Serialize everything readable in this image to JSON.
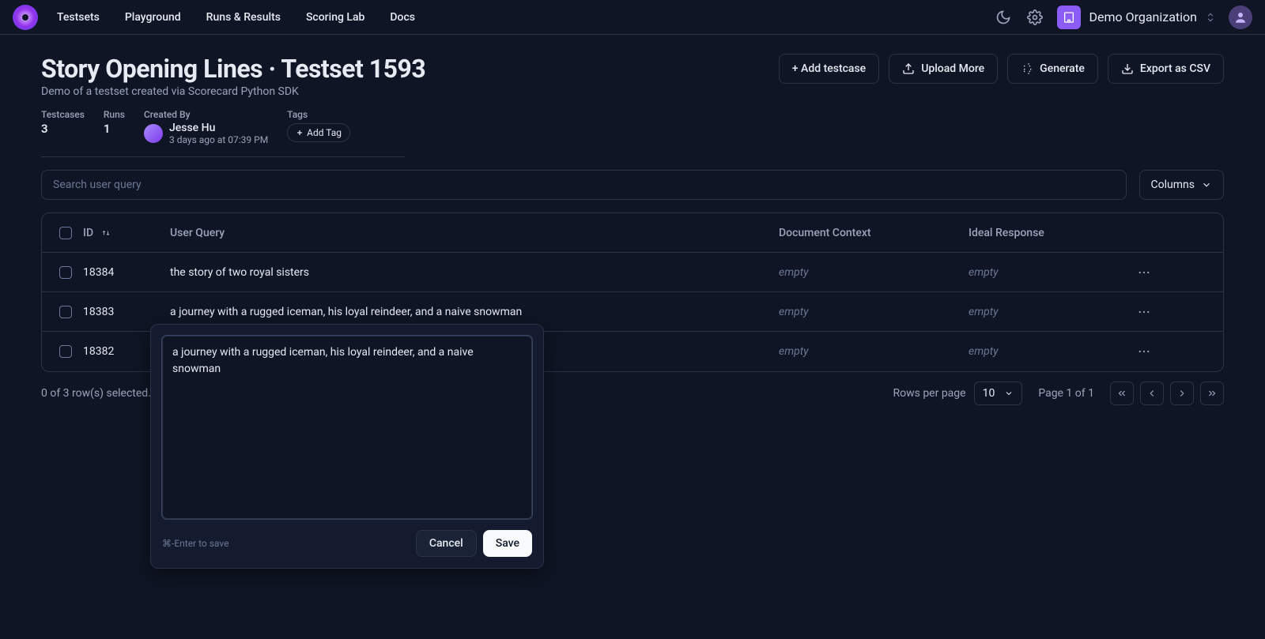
{
  "nav": {
    "items": [
      "Testsets",
      "Playground",
      "Runs & Results",
      "Scoring Lab",
      "Docs"
    ]
  },
  "org": {
    "name": "Demo Organization"
  },
  "page": {
    "title": "Story Opening Lines · Testset 1593",
    "subtitle": "Demo of a testset created via Scorecard Python SDK"
  },
  "meta": {
    "testcases_label": "Testcases",
    "testcases_value": "3",
    "runs_label": "Runs",
    "runs_value": "1",
    "created_by_label": "Created By",
    "creator_name": "Jesse Hu",
    "creator_time": "3 days ago at 07:39 PM",
    "tags_label": "Tags",
    "add_tag": "Add Tag"
  },
  "actions": {
    "add_testcase": "+ Add testcase",
    "upload_more": "Upload More",
    "generate": "Generate",
    "export_csv": "Export as CSV"
  },
  "toolbar": {
    "search_placeholder": "Search user query",
    "columns": "Columns"
  },
  "table": {
    "headers": {
      "id": "ID",
      "user_query": "User Query",
      "doc_context": "Document Context",
      "ideal_response": "Ideal Response"
    },
    "rows": [
      {
        "id": "18384",
        "query": "the story of two royal sisters",
        "doc": "empty",
        "ideal": "empty"
      },
      {
        "id": "18383",
        "query": "a journey with a rugged iceman, his loyal reindeer, and a naive snowman",
        "doc": "empty",
        "ideal": "empty"
      },
      {
        "id": "18382",
        "query": "",
        "doc": "empty",
        "ideal": "empty"
      }
    ]
  },
  "popover": {
    "value": "a journey with a rugged iceman, his loyal reindeer, and a naive snowman",
    "hint": "⌘-Enter to save",
    "cancel": "Cancel",
    "save": "Save"
  },
  "footer": {
    "selection": "0 of 3 row(s) selected.",
    "rows_per_page": "Rows per page",
    "rpp_value": "10",
    "page_info": "Page 1 of 1"
  }
}
